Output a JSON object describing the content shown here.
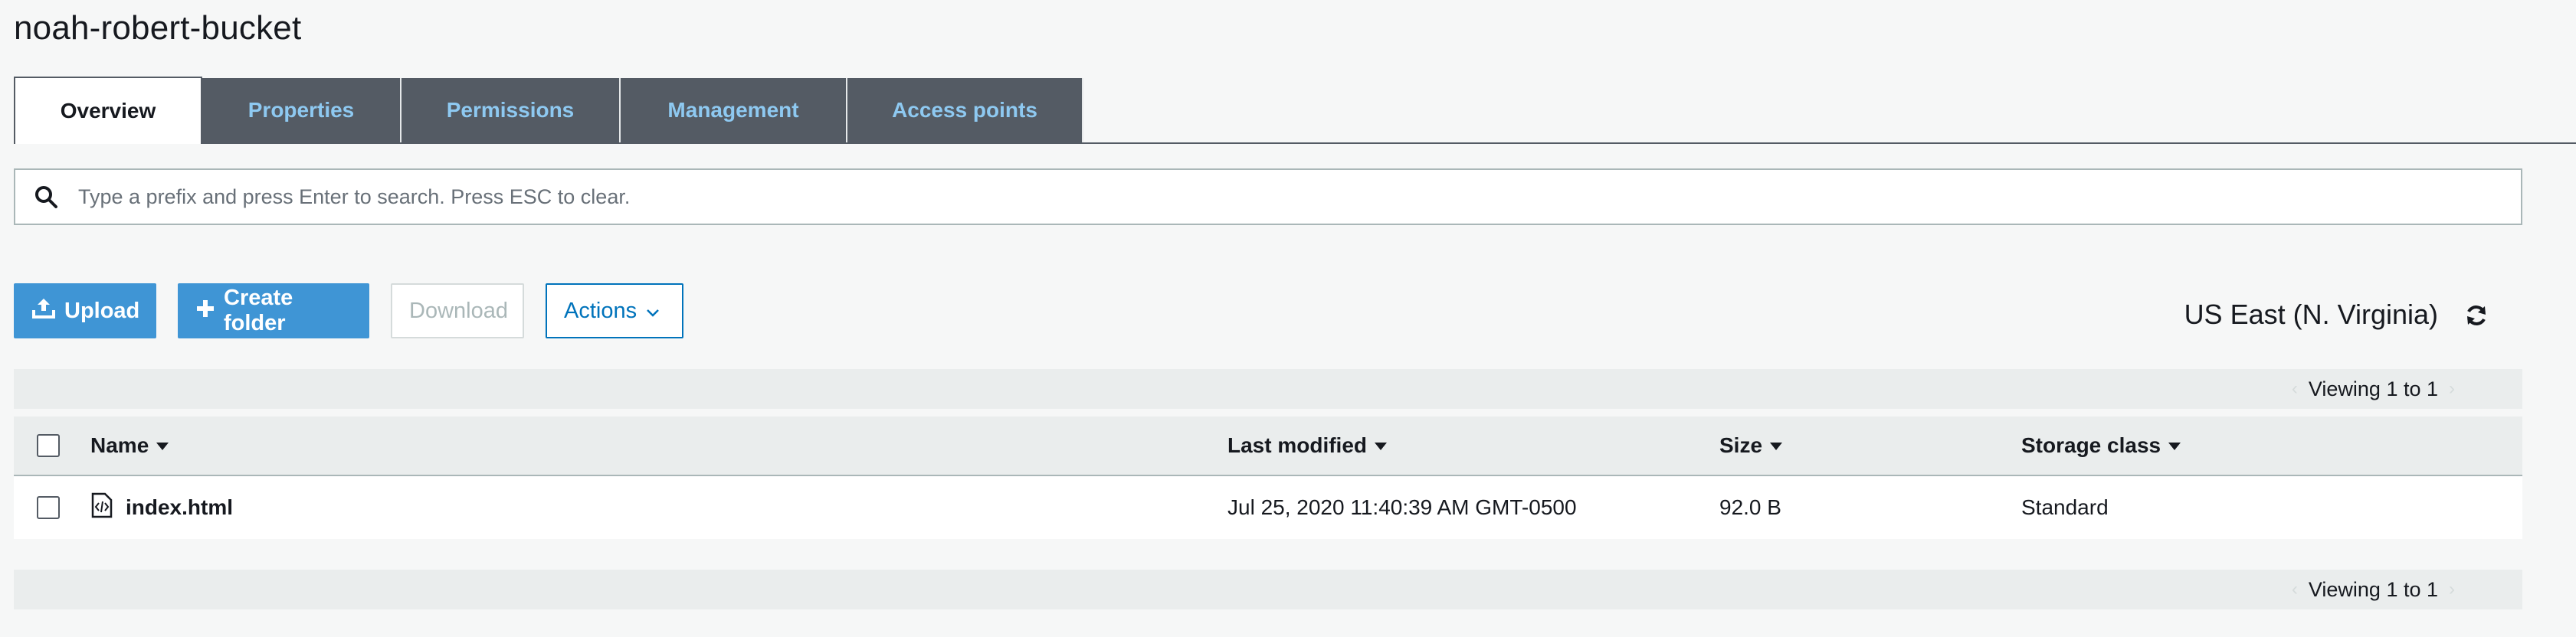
{
  "bucket": {
    "title": "noah-robert-bucket"
  },
  "tabs": [
    {
      "label": "Overview",
      "active": true
    },
    {
      "label": "Properties"
    },
    {
      "label": "Permissions"
    },
    {
      "label": "Management"
    },
    {
      "label": "Access points"
    }
  ],
  "search": {
    "placeholder": "Type a prefix and press Enter to search. Press ESC to clear.",
    "value": ""
  },
  "toolbar": {
    "upload_label": "Upload",
    "create_folder_label": "Create folder",
    "download_label": "Download",
    "actions_label": "Actions"
  },
  "region": {
    "label": "US East (N. Virginia)"
  },
  "pager": {
    "top_label": "Viewing 1 to 1",
    "bottom_label": "Viewing 1 to 1"
  },
  "table": {
    "columns": {
      "name": "Name",
      "last_modified": "Last modified",
      "size": "Size",
      "storage_class": "Storage class"
    },
    "rows": [
      {
        "name": "index.html",
        "last_modified": "Jul 25, 2020 11:40:39 AM GMT-0500",
        "size": "92.0 B",
        "storage_class": "Standard"
      }
    ]
  },
  "colors": {
    "tab_inactive_bg": "#545b64",
    "tab_inactive_text": "#8ec9f1",
    "primary_button": "#3f95d5",
    "link_blue": "#0073bb"
  },
  "icons": [
    "search-icon",
    "upload-icon",
    "plus-icon",
    "chevron-down-icon",
    "refresh-icon",
    "file-code-icon",
    "sort-caret-icon"
  ]
}
